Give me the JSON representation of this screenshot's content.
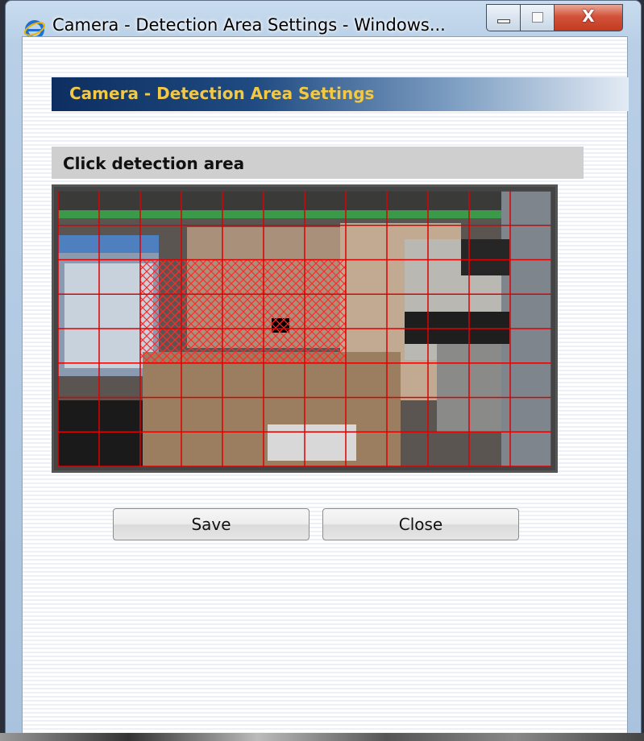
{
  "window": {
    "title": "Camera - Detection Area Settings - Windows...",
    "controls": {
      "minimize": "minimize",
      "maximize": "maximize",
      "close": "X"
    }
  },
  "header": {
    "title": "Camera  - Detection Area Settings"
  },
  "section": {
    "title": "Click detection area"
  },
  "grid": {
    "columns": 12,
    "rows": 8,
    "selected_cells": [
      [
        2,
        2
      ],
      [
        3,
        2
      ],
      [
        4,
        2
      ],
      [
        5,
        2
      ],
      [
        6,
        2
      ],
      [
        2,
        3
      ],
      [
        3,
        3
      ],
      [
        4,
        3
      ],
      [
        5,
        3
      ],
      [
        6,
        3
      ],
      [
        2,
        4
      ],
      [
        3,
        4
      ],
      [
        4,
        4
      ],
      [
        5,
        4
      ],
      [
        6,
        4
      ]
    ],
    "line_color": "#e00000"
  },
  "buttons": {
    "save": "Save",
    "close": "Close"
  },
  "colors": {
    "header_text": "#f2c844",
    "header_bg_start": "#0d2e60"
  }
}
